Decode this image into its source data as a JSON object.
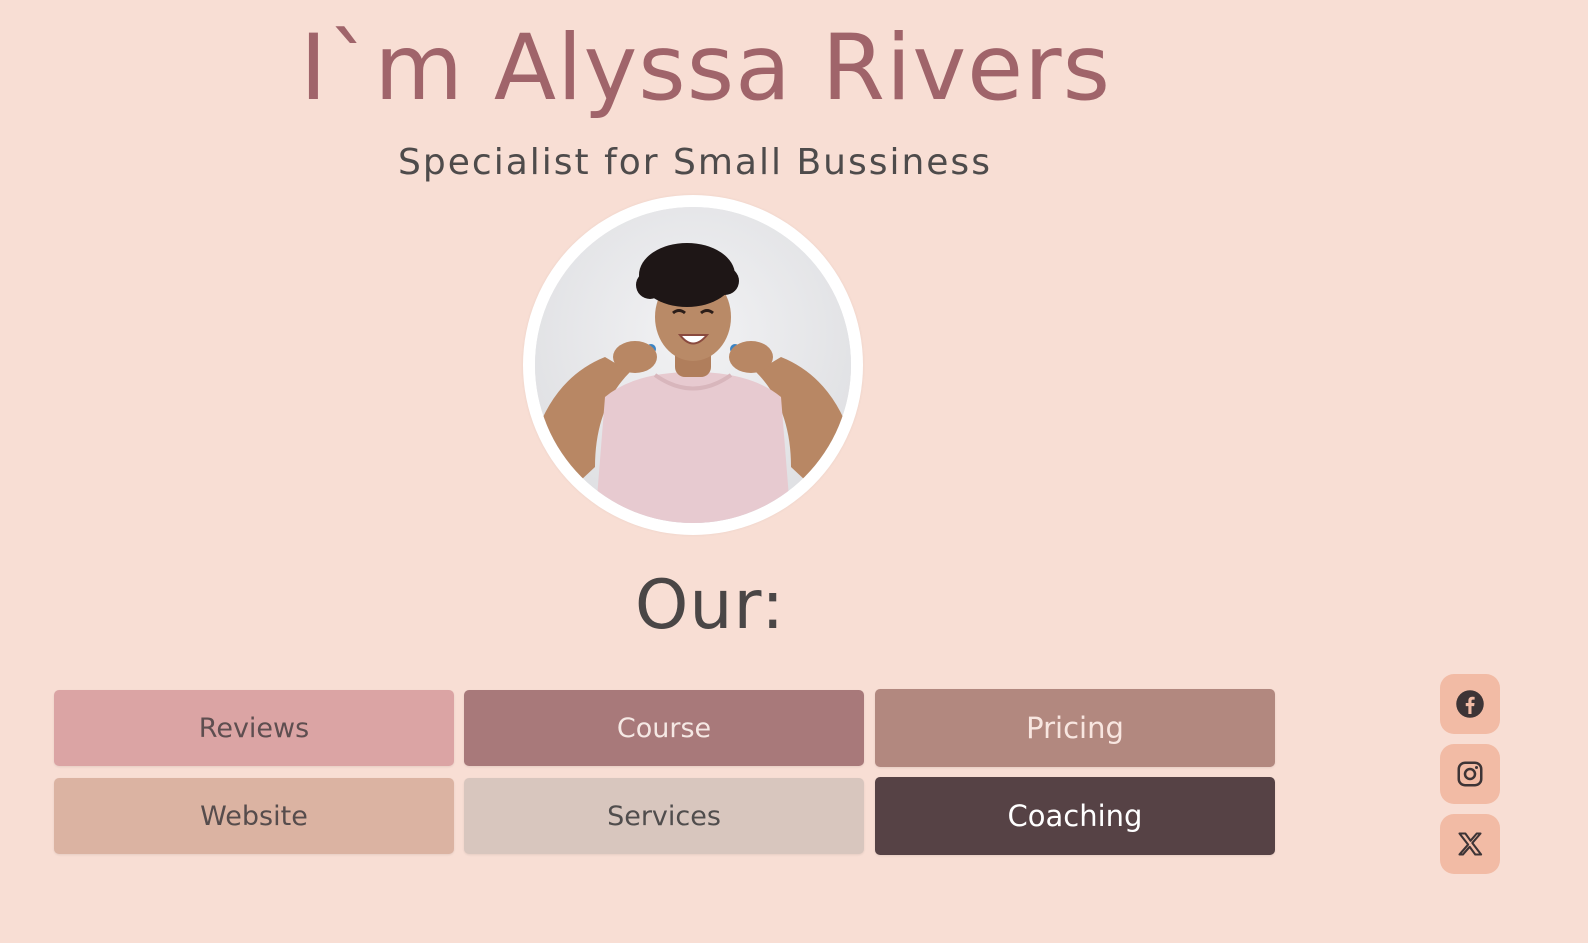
{
  "hero": {
    "title": "I`m Alyssa Rivers",
    "subtitle": "Specialist for Small Bussiness"
  },
  "section": {
    "title": "Our:"
  },
  "nav": {
    "reviews": "Reviews",
    "course": "Course",
    "pricing": "Pricing",
    "website": "Website",
    "services": "Services",
    "coaching": "Coaching"
  },
  "social": {
    "icons": [
      "facebook-icon",
      "instagram-icon",
      "x-icon"
    ]
  },
  "colors": {
    "background": "#f8ded4",
    "title": "#a0646a",
    "text_dark": "#4a4646",
    "social_bg": "#f2bba5",
    "reviews_bg": "#dba4a4",
    "course_bg": "#a8797a",
    "pricing_bg": "#b2887f",
    "website_bg": "#dbb3a2",
    "services_bg": "#d8c6be",
    "coaching_bg": "#564245"
  }
}
